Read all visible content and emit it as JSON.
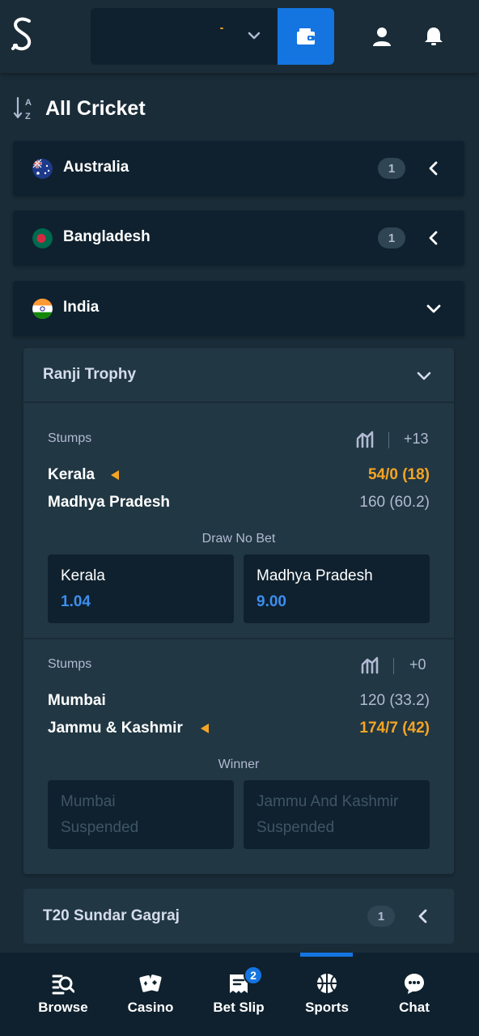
{
  "header": {
    "logo_icon": "stake-s-logo",
    "wallet_icon": "wallet-icon",
    "profile_icon": "user-icon",
    "notifications_icon": "bell-icon",
    "accent_color": "#1475e1"
  },
  "page": {
    "title": "All Cricket",
    "sort_icon": "sort-az-icon"
  },
  "countries": [
    {
      "name": "Australia",
      "count": "1",
      "expanded": false
    },
    {
      "name": "Bangladesh",
      "count": "1",
      "expanded": false
    },
    {
      "name": "India",
      "count": "",
      "expanded": true
    }
  ],
  "tournament": {
    "name": "Ranji Trophy",
    "matches": [
      {
        "status": "Stumps",
        "more_markets": "+13",
        "team1": "Kerala",
        "team1_score": "54/0 (18)",
        "team1_batting": true,
        "team2": "Madhya Pradesh",
        "team2_score": "160 (60.2)",
        "team2_batting": false,
        "market": "Draw No Bet",
        "outcomes": [
          {
            "name": "Kerala",
            "odds": "1.04"
          },
          {
            "name": "Madhya Pradesh",
            "odds": "9.00"
          }
        ]
      },
      {
        "status": "Stumps",
        "more_markets": "+0",
        "team1": "Mumbai",
        "team1_score": "120 (33.2)",
        "team1_batting": false,
        "team2": "Jammu & Kashmir",
        "team2_score": "174/7 (42)",
        "team2_batting": true,
        "market": "Winner",
        "outcomes": [
          {
            "name": "Mumbai",
            "odds": "Suspended"
          },
          {
            "name": "Jammu And Kashmir",
            "odds": "Suspended"
          }
        ]
      }
    ]
  },
  "other_tournament": {
    "name": "T20 Sundar Gagraj",
    "count": "1"
  },
  "bottom_nav": {
    "items": [
      {
        "label": "Browse",
        "icon": "browse-icon"
      },
      {
        "label": "Casino",
        "icon": "casino-cards-icon"
      },
      {
        "label": "Bet Slip",
        "icon": "bet-slip-icon",
        "badge": "2"
      },
      {
        "label": "Sports",
        "icon": "basketball-icon",
        "active": true
      },
      {
        "label": "Chat",
        "icon": "chat-bubble-icon"
      }
    ]
  }
}
